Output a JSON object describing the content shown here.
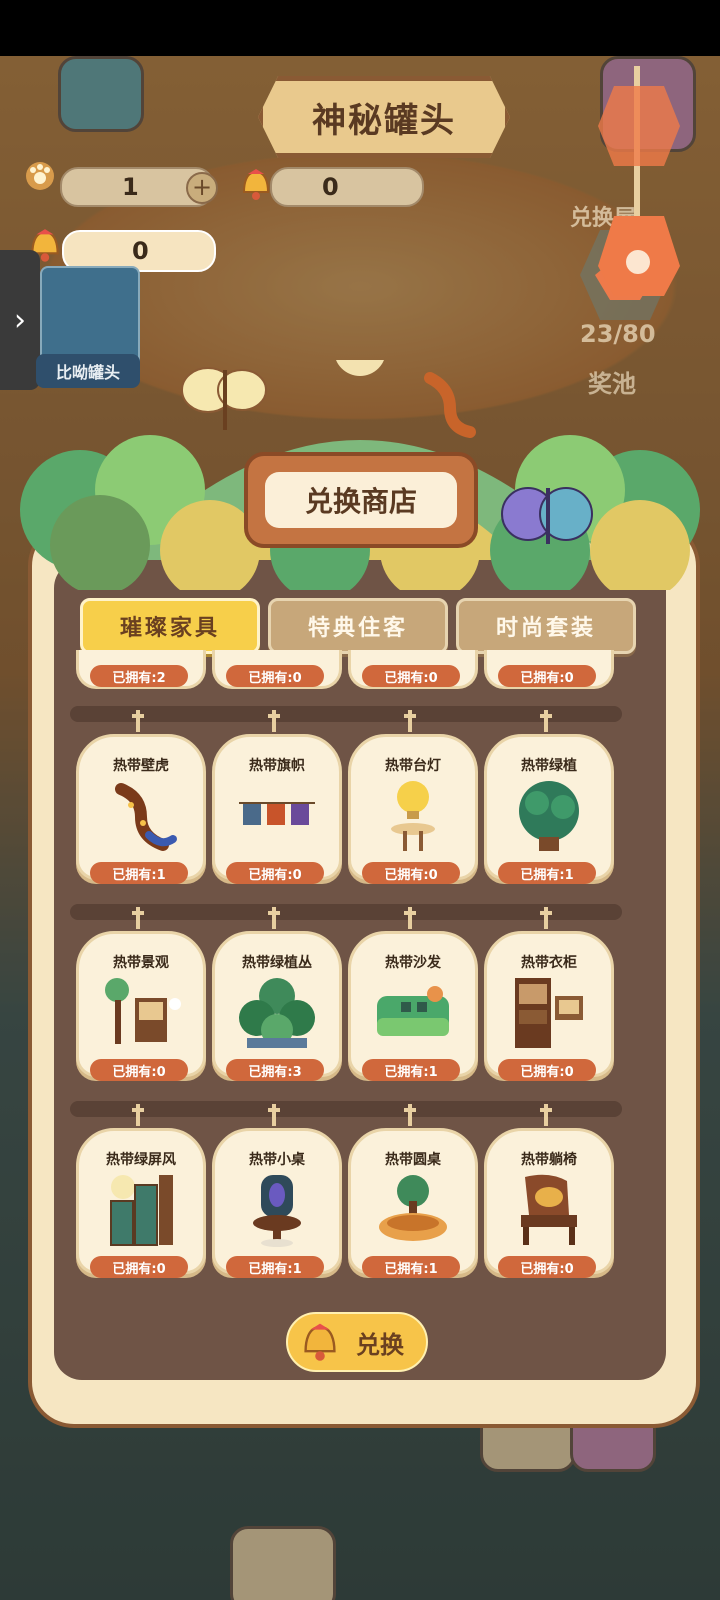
{
  "header": {
    "title": "神秘罐头",
    "ticket_count": "1",
    "bell_count": "0",
    "bell_balance": "0"
  },
  "side": {
    "left_label": "比呦罐头",
    "exchange_house_label": "兑换屋",
    "progress": "23/80",
    "prize_pool_label": "奖池"
  },
  "shop": {
    "title": "兑换商店",
    "tabs": [
      {
        "label": "璀璨家具",
        "active": true
      },
      {
        "label": "特典住客",
        "active": false
      },
      {
        "label": "时尚套装",
        "active": false
      }
    ],
    "top_row_owned": [
      "已拥有:2",
      "已拥有:0",
      "已拥有:0",
      "已拥有:0"
    ],
    "rows": [
      [
        {
          "name": "热带壁虎",
          "owned": "已拥有:1",
          "icon": "gecko-icon"
        },
        {
          "name": "热带旗帜",
          "owned": "已拥有:0",
          "icon": "flag-bunting-icon"
        },
        {
          "name": "热带台灯",
          "owned": "已拥有:0",
          "icon": "lamp-icon"
        },
        {
          "name": "热带绿植",
          "owned": "已拥有:1",
          "icon": "plant-icon"
        }
      ],
      [
        {
          "name": "热带景观",
          "owned": "已拥有:0",
          "icon": "landscape-icon"
        },
        {
          "name": "热带绿植丛",
          "owned": "已拥有:3",
          "icon": "plant-cluster-icon"
        },
        {
          "name": "热带沙发",
          "owned": "已拥有:1",
          "icon": "sofa-icon"
        },
        {
          "name": "热带衣柜",
          "owned": "已拥有:0",
          "icon": "wardrobe-icon"
        }
      ],
      [
        {
          "name": "热带绿屏风",
          "owned": "已拥有:0",
          "icon": "screen-icon"
        },
        {
          "name": "热带小桌",
          "owned": "已拥有:1",
          "icon": "small-table-icon"
        },
        {
          "name": "热带圆桌",
          "owned": "已拥有:1",
          "icon": "round-table-icon"
        },
        {
          "name": "热带躺椅",
          "owned": "已拥有:0",
          "icon": "lounge-chair-icon"
        }
      ]
    ],
    "exchange_button": "兑换"
  },
  "colors": {
    "accent": "#f7cf4a",
    "owned_badge": "#d0683c",
    "panel": "#f6e6c2",
    "inner": "#6f5446"
  }
}
